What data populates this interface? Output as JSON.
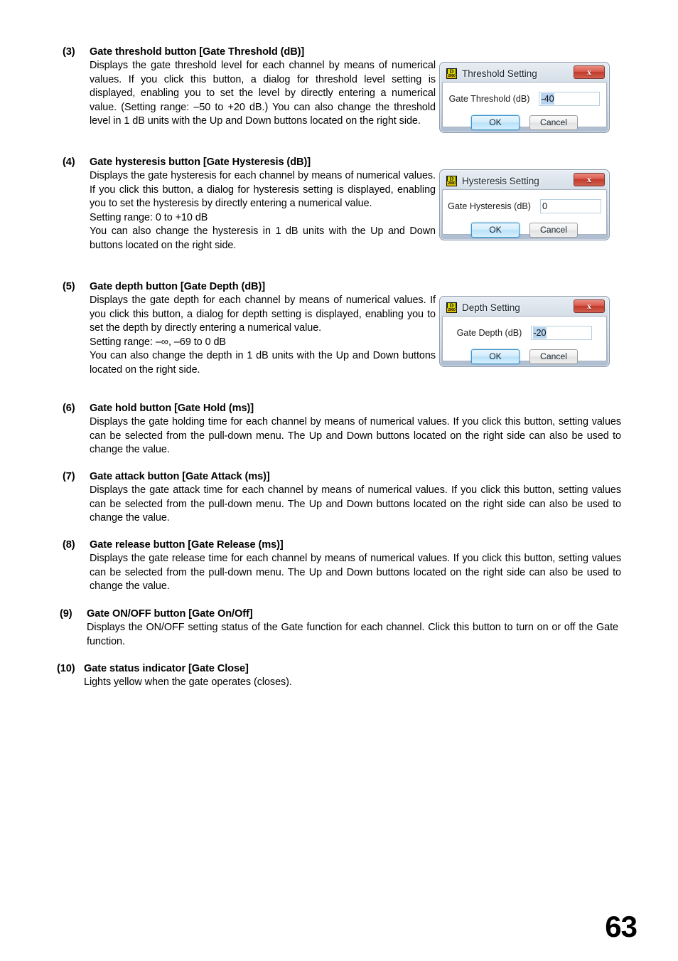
{
  "page": {
    "number": "63"
  },
  "sections": [
    {
      "number": "(3)",
      "title": "Gate threshold button [Gate Threshold (dB)]",
      "paragraphs": [
        "Displays the gate threshold level for each channel by means of numerical values. If you click this button, a dialog for threshold level setting is displayed, enabling you to set the level by directly entering a numerical value. (Setting range: –50 to +20 dB.) You can also change the threshold level in 1 dB units with the Up and Down buttons located on the right side."
      ]
    },
    {
      "number": "(4)",
      "title": "Gate hysteresis button [Gate Hysteresis (dB)]",
      "paragraphs": [
        "Displays the gate hysteresis for each channel by means of numerical values. If you click this button, a dialog for hysteresis setting is displayed, enabling you to set the hysteresis by directly entering a numerical value.",
        "Setting range: 0 to +10 dB",
        "You can also change the hysteresis in 1 dB units with the Up and Down buttons located on the right side."
      ]
    },
    {
      "number": "(5)",
      "title": "Gate depth button [Gate Depth (dB)]",
      "paragraphs": [
        "Displays the gate depth for each channel by means of numerical values. If you click this button, a dialog for depth setting is displayed, enabling you to set the depth by directly entering a numerical value.",
        "Setting range: –∞, –69 to 0 dB",
        "You can also change the depth in 1 dB units with the Up and Down buttons located on the right side."
      ]
    },
    {
      "number": "(6)",
      "title": "Gate hold button [Gate Hold (ms)]",
      "paragraphs": [
        "Displays the gate holding time for each channel by means of numerical values. If you click this button, setting values can be selected from the pull-down menu. The Up and Down buttons located on the right side can also be used to change the value."
      ]
    },
    {
      "number": "(7)",
      "title": "Gate attack button [Gate Attack (ms)]",
      "paragraphs": [
        "Displays the gate attack time for each channel by means of numerical values. If you click this button, setting values can be selected from the pull-down menu. The Up and Down buttons located on the right side can also be used to change the value."
      ]
    },
    {
      "number": "(8)",
      "title": "Gate release button [Gate Release (ms)]",
      "paragraphs": [
        "Displays the gate release time for each channel by means of numerical values. If you click this button, setting values can be selected from the pull-down menu. The Up and Down buttons located on the right side can also be used to change the value."
      ]
    },
    {
      "number": "(9)",
      "title": "Gate ON/OFF button [Gate On/Off]",
      "paragraphs": [
        "Displays the ON/OFF setting status of the Gate function for each channel. Click this button to turn on or off the Gate function."
      ]
    },
    {
      "number": "(10)",
      "title": "Gate status indicator [Gate Close]",
      "paragraphs": [
        "Lights yellow when the gate operates (closes)."
      ]
    }
  ],
  "dialogs": [
    {
      "title": "Threshold Setting",
      "icon": "app-d2000-icon",
      "icon_text_top": "D",
      "icon_text_bottom": "2000",
      "close_label": "x",
      "field_label": "Gate Threshold (dB)",
      "field_value": "-40",
      "ok_label": "OK",
      "cancel_label": "Cancel"
    },
    {
      "title": "Hysteresis Setting",
      "icon": "app-d2000-icon",
      "icon_text_top": "D",
      "icon_text_bottom": "2000",
      "close_label": "x",
      "field_label": "Gate Hysteresis (dB)",
      "field_value": "0",
      "ok_label": "OK",
      "cancel_label": "Cancel"
    },
    {
      "title": "Depth Setting",
      "icon": "app-d2000-icon",
      "icon_text_top": "D",
      "icon_text_bottom": "2000",
      "close_label": "x",
      "field_label": "Gate Depth (dB)",
      "field_value": "-20",
      "ok_label": "OK",
      "cancel_label": "Cancel"
    }
  ],
  "colors": {
    "close_button_red": "#c23a2c",
    "default_button_blue": "#3d95cc",
    "selection_blue": "#b6d4f0",
    "icon_yellow": "#d8d800"
  }
}
